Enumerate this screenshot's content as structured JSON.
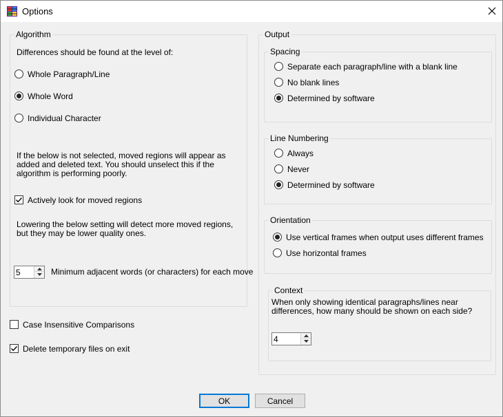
{
  "window": {
    "title": "Options"
  },
  "algorithm": {
    "legend": "Algorithm",
    "level_prompt": "Differences should be found at the level of:",
    "levels": [
      {
        "label": "Whole Paragraph/Line",
        "checked": false
      },
      {
        "label": "Whole Word",
        "checked": true
      },
      {
        "label": "Individual Character",
        "checked": false
      }
    ],
    "moved_info": "If the below is not selected, moved regions will appear as added and deleted text. You should unselect this if the algorithm is performing poorly.",
    "moved_checkbox": {
      "label": "Actively look for moved regions",
      "checked": true
    },
    "lower_info": "Lowering the below setting will detect more moved regions, but they may be lower quality ones.",
    "min_words": {
      "value": "5",
      "label": "Minimum adjacent words (or characters) for each move"
    }
  },
  "case_insensitive": {
    "label": "Case Insensitive Comparisons",
    "checked": false
  },
  "delete_temp": {
    "label": "Delete temporary files on exit",
    "checked": true
  },
  "output": {
    "legend": "Output",
    "spacing": {
      "legend": "Spacing",
      "options": [
        {
          "label": "Separate each paragraph/line with a blank line",
          "checked": false
        },
        {
          "label": "No blank lines",
          "checked": false
        },
        {
          "label": "Determined by software",
          "checked": true
        }
      ]
    },
    "line_numbering": {
      "legend": "Line Numbering",
      "options": [
        {
          "label": "Always",
          "checked": false
        },
        {
          "label": "Never",
          "checked": false
        },
        {
          "label": "Determined by software",
          "checked": true
        }
      ]
    },
    "orientation": {
      "legend": "Orientation",
      "options": [
        {
          "label": "Use vertical frames when output uses different frames",
          "checked": true
        },
        {
          "label": "Use horizontal frames",
          "checked": false
        }
      ]
    },
    "context": {
      "legend": "Context",
      "info": "When only showing identical paragraphs/lines near differences, how many should be shown on each side?",
      "value": "4"
    }
  },
  "buttons": {
    "ok": "OK",
    "cancel": "Cancel"
  }
}
